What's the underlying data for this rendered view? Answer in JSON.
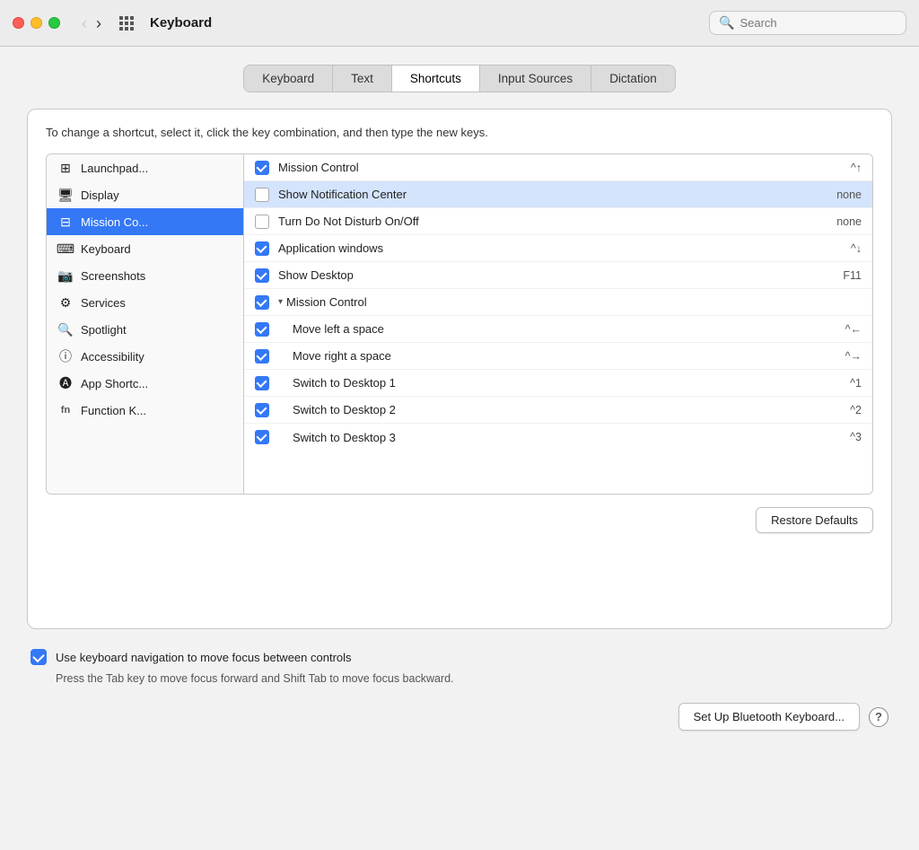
{
  "titlebar": {
    "title": "Keyboard",
    "search_placeholder": "Search"
  },
  "tabs": [
    {
      "id": "keyboard",
      "label": "Keyboard",
      "active": false
    },
    {
      "id": "text",
      "label": "Text",
      "active": false
    },
    {
      "id": "shortcuts",
      "label": "Shortcuts",
      "active": true
    },
    {
      "id": "input-sources",
      "label": "Input Sources",
      "active": false
    },
    {
      "id": "dictation",
      "label": "Dictation",
      "active": false
    }
  ],
  "instruction": "To change a shortcut, select it, click the key combination, and then type the new keys.",
  "sidebar": {
    "items": [
      {
        "id": "launchpad",
        "icon": "⊞",
        "label": "Launchpad...",
        "selected": false
      },
      {
        "id": "display",
        "icon": "🖥",
        "label": "Display",
        "selected": false
      },
      {
        "id": "mission-control",
        "icon": "⊟",
        "label": "Mission Co...",
        "selected": true
      },
      {
        "id": "keyboard",
        "icon": "⌨",
        "label": "Keyboard",
        "selected": false
      },
      {
        "id": "screenshots",
        "icon": "📷",
        "label": "Screenshots",
        "selected": false
      },
      {
        "id": "services",
        "icon": "⚙",
        "label": "Services",
        "selected": false
      },
      {
        "id": "spotlight",
        "icon": "🔍",
        "label": "Spotlight",
        "selected": false
      },
      {
        "id": "accessibility",
        "icon": "♿",
        "label": "Accessibility",
        "selected": false
      },
      {
        "id": "app-shortcuts",
        "icon": "🅐",
        "label": "App Shortc...",
        "selected": false
      },
      {
        "id": "function-keys",
        "icon": "fn",
        "label": "Function K...",
        "selected": false
      }
    ]
  },
  "shortcuts": [
    {
      "id": "mission-control-main",
      "label": "Mission Control",
      "key": "^↑",
      "checked": true,
      "indented": false,
      "highlighted": false
    },
    {
      "id": "show-notification-center",
      "label": "Show Notification Center",
      "key": "none",
      "checked": false,
      "indented": false,
      "highlighted": true
    },
    {
      "id": "turn-do-not-disturb",
      "label": "Turn Do Not Disturb On/Off",
      "key": "none",
      "checked": false,
      "indented": false,
      "highlighted": false
    },
    {
      "id": "application-windows",
      "label": "Application windows",
      "key": "^↓",
      "checked": true,
      "indented": false,
      "highlighted": false
    },
    {
      "id": "show-desktop",
      "label": "Show Desktop",
      "key": "F11",
      "checked": true,
      "indented": false,
      "highlighted": false
    },
    {
      "id": "mission-control-section",
      "label": "Mission Control",
      "key": "",
      "checked": true,
      "indented": false,
      "highlighted": false,
      "section": true
    },
    {
      "id": "move-left-space",
      "label": "Move left a space",
      "key": "^←",
      "checked": true,
      "indented": true,
      "highlighted": false
    },
    {
      "id": "move-right-space",
      "label": "Move right a space",
      "key": "^→",
      "checked": true,
      "indented": true,
      "highlighted": false
    },
    {
      "id": "switch-desktop-1",
      "label": "Switch to Desktop 1",
      "key": "^1",
      "checked": true,
      "indented": true,
      "highlighted": false
    },
    {
      "id": "switch-desktop-2",
      "label": "Switch to Desktop 2",
      "key": "^2",
      "checked": true,
      "indented": true,
      "highlighted": false
    },
    {
      "id": "switch-desktop-3",
      "label": "Switch to Desktop 3",
      "key": "^3",
      "checked": true,
      "indented": true,
      "highlighted": false
    }
  ],
  "restore_defaults_label": "Restore Defaults",
  "nav_keyboard": {
    "checkbox_label": "Use keyboard navigation to move focus between controls",
    "description": "Press the Tab key to move focus forward and Shift Tab to move focus backward."
  },
  "footer": {
    "bluetooth_btn": "Set Up Bluetooth Keyboard...",
    "help_btn": "?"
  }
}
